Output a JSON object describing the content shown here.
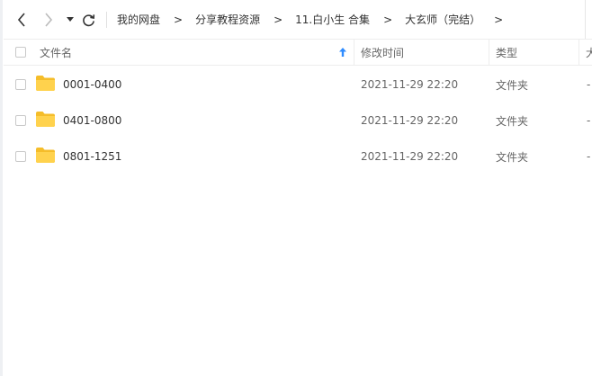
{
  "toolbar": {
    "back_icon": "chevron-left-icon",
    "forward_icon": "chevron-right-icon",
    "dropdown_icon": "caret-down-icon",
    "refresh_icon": "refresh-icon",
    "breadcrumb": [
      {
        "label": "我的网盘"
      },
      {
        "label": "分享教程资源"
      },
      {
        "label": "11.白小生 合集"
      },
      {
        "label": "大玄师（完结）"
      }
    ],
    "separator": ">"
  },
  "header": {
    "name_label": "文件名",
    "modified_label": "修改时间",
    "type_label": "类型",
    "size_label": "大",
    "sort_icon": "sort-up-arrow-icon",
    "sort_color": "#2f8cff"
  },
  "files": [
    {
      "name": "0001-0400",
      "modified": "2021-11-29 22:20",
      "type": "文件夹",
      "size": "-"
    },
    {
      "name": "0401-0800",
      "modified": "2021-11-29 22:20",
      "type": "文件夹",
      "size": "-"
    },
    {
      "name": "0801-1251",
      "modified": "2021-11-29 22:20",
      "type": "文件夹",
      "size": "-"
    }
  ],
  "colors": {
    "folder": "#ffd24d",
    "folder_dark": "#f5bd2a",
    "text": "#333333",
    "muted": "#666666",
    "border": "#ededed"
  }
}
